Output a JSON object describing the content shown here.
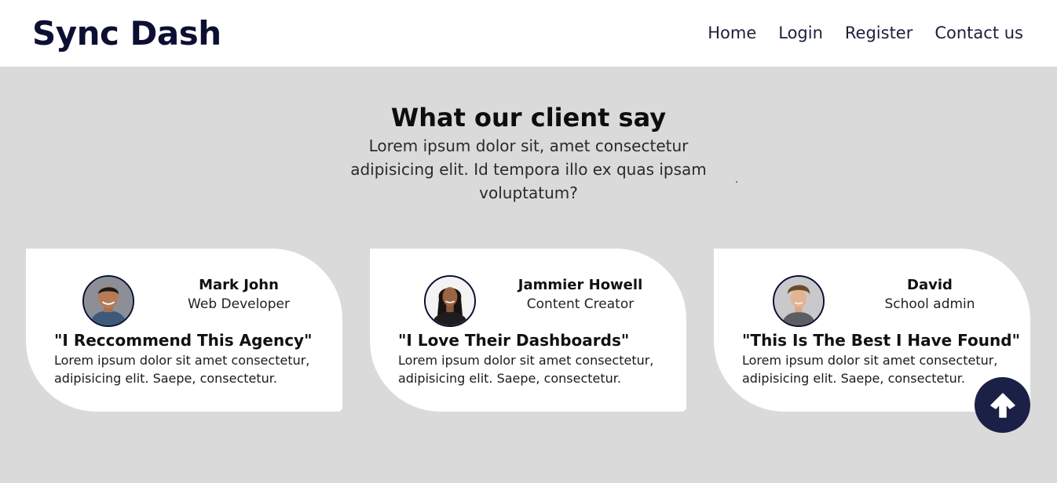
{
  "navbar": {
    "brand": "Sync Dash",
    "links": [
      "Home",
      "Login",
      "Register",
      "Contact us"
    ]
  },
  "section": {
    "title": "What our client say",
    "subtitle": "Lorem ipsum dolor sit, amet consectetur adipisicing elit. Id tempora illo ex quas ipsam voluptatum?"
  },
  "testimonials": [
    {
      "name": "Mark John",
      "role": "Web Developer",
      "quote": "\"I Reccommend This Agency\"",
      "body": "Lorem ipsum dolor sit amet consectetur, adipisicing elit. Saepe, consectetur."
    },
    {
      "name": "Jammier Howell",
      "role": "Content Creator",
      "quote": "\"I Love Their Dashboards\"",
      "body": "Lorem ipsum dolor sit amet consectetur, adipisicing elit. Saepe, consectetur."
    },
    {
      "name": "David",
      "role": "School admin",
      "quote": "\"This Is The Best I Have Found\"",
      "body": "Lorem ipsum dolor sit amet consectetur, adipisicing elit. Saepe, consectetur."
    }
  ],
  "scroll_top": {
    "icon": "arrow-up-icon"
  },
  "colors": {
    "brand": "#0b1033",
    "background": "#dadada",
    "card": "#ffffff",
    "scroll_button": "#1b2047"
  }
}
